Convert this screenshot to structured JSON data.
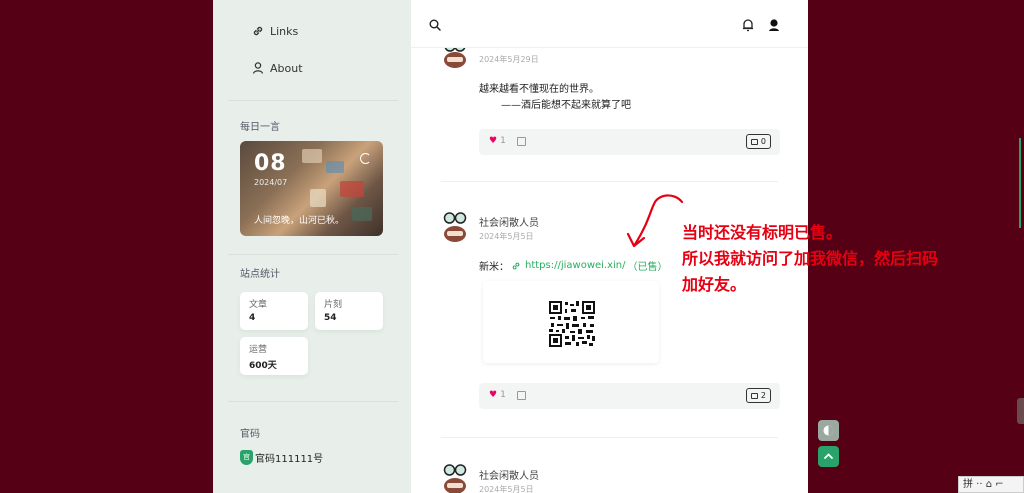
{
  "sidebar": {
    "nav": [
      {
        "label": "Links",
        "icon": "link-icon"
      },
      {
        "label": "About",
        "icon": "user-icon"
      }
    ],
    "daily_quote": {
      "title": "每日一言",
      "day": "08",
      "month": "2024/07",
      "text": "人间忽晚，山河已秋。"
    },
    "stats": {
      "title": "站点统计",
      "items": [
        {
          "label": "文章",
          "value": "4"
        },
        {
          "label": "片刻",
          "value": "54"
        },
        {
          "label": "运营",
          "value": "600天"
        }
      ]
    },
    "icp": {
      "title": "官码",
      "badge": "官",
      "text": "官码111111号"
    }
  },
  "posts": [
    {
      "author": "",
      "date": "2024年5月29日",
      "lines": [
        "越来越看不懂现在的世界。",
        "——酒后能想不起来就算了吧"
      ],
      "likes": "1",
      "comments": "0"
    },
    {
      "author": "社会闲散人员",
      "date": "2024年5月5日",
      "prefix": "新米：",
      "link": "https://jiawowei.xin/",
      "link_tag": "（已售）",
      "likes": "1",
      "comments": "2"
    },
    {
      "author": "社会闲散人员",
      "date": "2024年5月5日"
    }
  ],
  "annotation": {
    "lines": [
      "当时还没有标明已售。",
      "所以我就访问了加我微信，然后扫码",
      "加好友。"
    ],
    "color": "#e60012"
  },
  "ime": {
    "text": "拼 ·· ⌂ ⌐"
  },
  "colors": {
    "background": "#560015",
    "accent": "#27ae60",
    "sidebar": "#e8efea"
  }
}
